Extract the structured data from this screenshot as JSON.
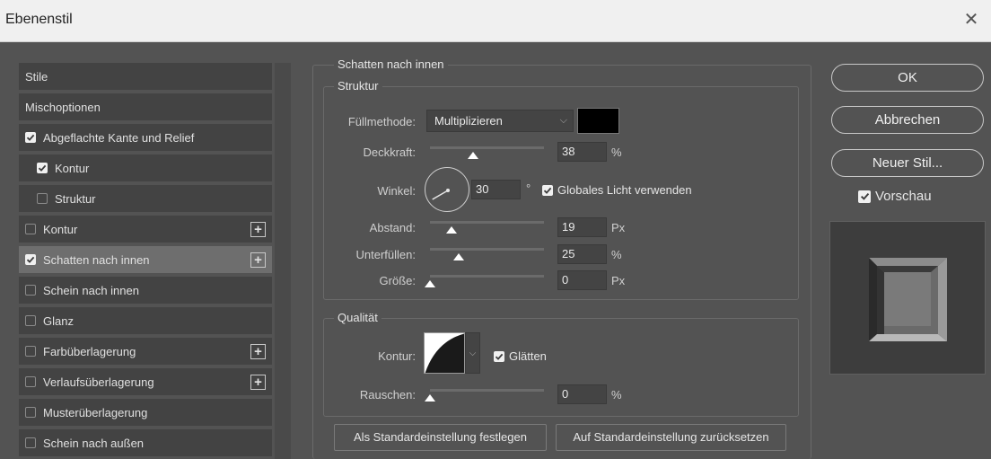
{
  "window": {
    "title": "Ebenenstil",
    "close_glyph": "✕"
  },
  "left_list": {
    "items": [
      {
        "label": "Stile",
        "checkbox": "none",
        "indent": false,
        "plus": false,
        "active": false
      },
      {
        "label": "Mischoptionen",
        "checkbox": "none",
        "indent": false,
        "plus": false,
        "active": false
      },
      {
        "label": "Abgeflachte Kante und Relief",
        "checkbox": "checked",
        "indent": false,
        "plus": false,
        "active": false
      },
      {
        "label": "Kontur",
        "checkbox": "checked",
        "indent": true,
        "plus": false,
        "active": false
      },
      {
        "label": "Struktur",
        "checkbox": "unchecked",
        "indent": true,
        "plus": false,
        "active": false
      },
      {
        "label": "Kontur",
        "checkbox": "unchecked",
        "indent": false,
        "plus": true,
        "active": false
      },
      {
        "label": "Schatten nach innen",
        "checkbox": "checked",
        "indent": false,
        "plus": true,
        "active": true
      },
      {
        "label": "Schein nach innen",
        "checkbox": "unchecked",
        "indent": false,
        "plus": false,
        "active": false
      },
      {
        "label": "Glanz",
        "checkbox": "unchecked",
        "indent": false,
        "plus": false,
        "active": false
      },
      {
        "label": "Farbüberlagerung",
        "checkbox": "unchecked",
        "indent": false,
        "plus": true,
        "active": false
      },
      {
        "label": "Verlaufsüberlagerung",
        "checkbox": "unchecked",
        "indent": false,
        "plus": true,
        "active": false
      },
      {
        "label": "Musterüberlagerung",
        "checkbox": "unchecked",
        "indent": false,
        "plus": false,
        "active": false
      },
      {
        "label": "Schein nach außen",
        "checkbox": "unchecked",
        "indent": false,
        "plus": false,
        "active": false
      }
    ]
  },
  "panel": {
    "section_title": "Schatten nach innen",
    "struktur": {
      "title": "Struktur",
      "fill_mode_label": "Füllmethode:",
      "fill_mode_value": "Multiplizieren",
      "swatch_color": "#000000",
      "opacity_label": "Deckkraft:",
      "opacity_value": "38",
      "opacity_unit": "%",
      "opacity_fraction": 0.38,
      "angle_label": "Winkel:",
      "angle_value": "30",
      "angle_deg": 30,
      "angle_unit": "°",
      "global_light_label": "Globales Licht verwenden",
      "distance_label": "Abstand:",
      "distance_value": "19",
      "distance_unit": "Px",
      "distance_fraction": 0.19,
      "choke_label": "Unterfüllen:",
      "choke_value": "25",
      "choke_unit": "%",
      "choke_fraction": 0.25,
      "size_label": "Größe:",
      "size_value": "0",
      "size_unit": "Px",
      "size_fraction": 0.0
    },
    "qualitaet": {
      "title": "Qualität",
      "contour_label": "Kontur:",
      "antialias_label": "Glätten",
      "noise_label": "Rauschen:",
      "noise_value": "0",
      "noise_unit": "%",
      "noise_fraction": 0.0
    },
    "buttons": {
      "set_default": "Als Standardeinstellung festlegen",
      "reset_default": "Auf Standardeinstellung zurücksetzen"
    }
  },
  "right": {
    "ok": "OK",
    "cancel": "Abbrechen",
    "new_style": "Neuer Stil...",
    "preview_label": "Vorschau"
  }
}
